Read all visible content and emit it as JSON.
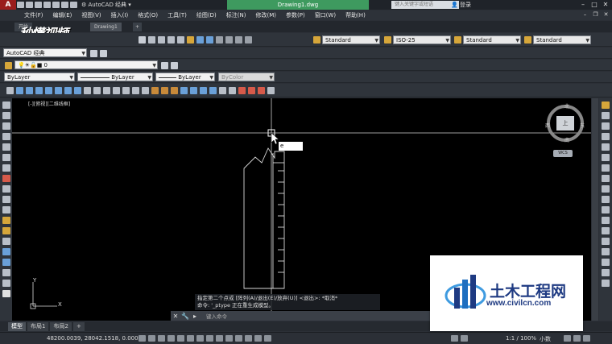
{
  "titlebar": {
    "app_logo": "A",
    "workspace": "AutoCAD 经典",
    "document": "Drawing1.dwg",
    "search_placeholder": "键入关键字或短语",
    "login": "登录"
  },
  "menu": [
    "文件(F)",
    "编辑(E)",
    "视图(V)",
    "插入(I)",
    "格式(O)",
    "工具(T)",
    "绘图(D)",
    "标注(N)",
    "修改(M)",
    "参数(P)",
    "窗口(W)",
    "帮助(H)"
  ],
  "tabs": {
    "start": "开始",
    "drawing": "Drawing1"
  },
  "watermark_logo": "秒懂视频",
  "styles_row": {
    "text_style": "Standard",
    "dim_style": "ISO-25",
    "table_style": "Standard",
    "multileader_style": "Standard"
  },
  "workspace_row": {
    "workspace": "AutoCAD 经典"
  },
  "layer_row": {
    "layer": "0"
  },
  "properties_row": {
    "color": "ByLayer",
    "linetype": "ByLayer",
    "lineweight": "ByLayer",
    "plotstyle": "ByColor"
  },
  "canvas": {
    "viewport_label": "[-][俯视][二维线框]",
    "input_value": "e",
    "ucs_y": "Y",
    "ucs_x": "X"
  },
  "viewcube": {
    "top": "北",
    "left": "西",
    "right": "东",
    "bottom": "南",
    "face": "上",
    "wcs": "WCS"
  },
  "command": {
    "history_1": "指定第二个点或 [阵列(A)/退出(E)/放弃(U)] <退出>: *取消*",
    "history_2": "命令: '_ptype 正在重生成模型。",
    "input_placeholder": "键入命令"
  },
  "layout_tabs": [
    "模型",
    "布局1",
    "布局2",
    "+"
  ],
  "status": {
    "coords": "48200.0039, 28042.1518, 0.0000",
    "scale": "1:1 / 100%",
    "annoscale": "小数"
  },
  "brand": {
    "name": "土木工程网",
    "url": "www.civilcn.com"
  },
  "colors": {
    "accent_doc_tab": "#3e9a5f",
    "canvas": "#000000",
    "brand_blue": "#1e3a82"
  }
}
